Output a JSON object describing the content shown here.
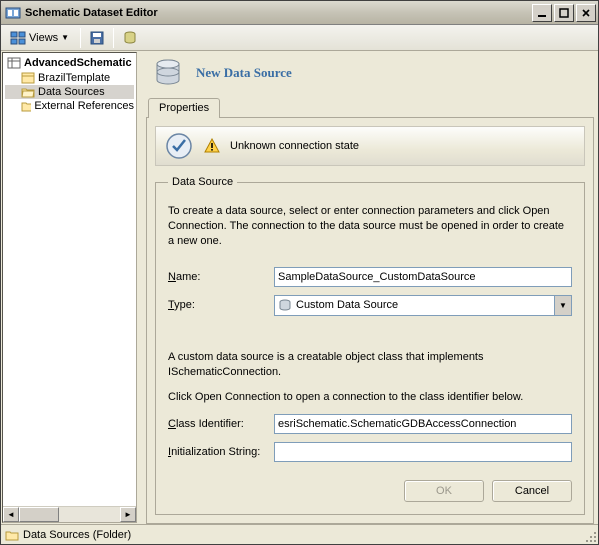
{
  "window": {
    "title": "Schematic Dataset Editor"
  },
  "toolbar": {
    "views_label": "Views"
  },
  "tree": {
    "root": "AdvancedSchematic",
    "items": [
      {
        "label": "BrazilTemplate"
      },
      {
        "label": "Data Sources"
      },
      {
        "label": "External References"
      }
    ]
  },
  "header": {
    "title": "New Data Source"
  },
  "tabs": {
    "properties": "Properties"
  },
  "status": {
    "text": "Unknown connection state"
  },
  "datasource": {
    "legend": "Data Source",
    "description": "To create a data source, select or enter connection parameters and click Open Connection.  The connection to the data source must be opened in order to create a new one.",
    "name_label_pre": "N",
    "name_label_post": "ame:",
    "name_value": "SampleDataSource_CustomDataSource",
    "type_label_pre": "T",
    "type_label_post": "ype:",
    "type_value": "Custom Data Source",
    "hint1": "A custom data source is a creatable object class that implements ISchematicConnection.",
    "hint2": "Click Open Connection to open a connection to the class identifier below.",
    "classid_label_pre": "C",
    "classid_label_post": "lass Identifier:",
    "classid_value": "esriSchematic.SchematicGDBAccessConnection",
    "init_label_pre": "I",
    "init_label_post": "nitialization String:",
    "init_value": ""
  },
  "buttons": {
    "ok": "OK",
    "cancel": "Cancel"
  },
  "statusbar": {
    "text": "Data Sources (Folder)"
  }
}
